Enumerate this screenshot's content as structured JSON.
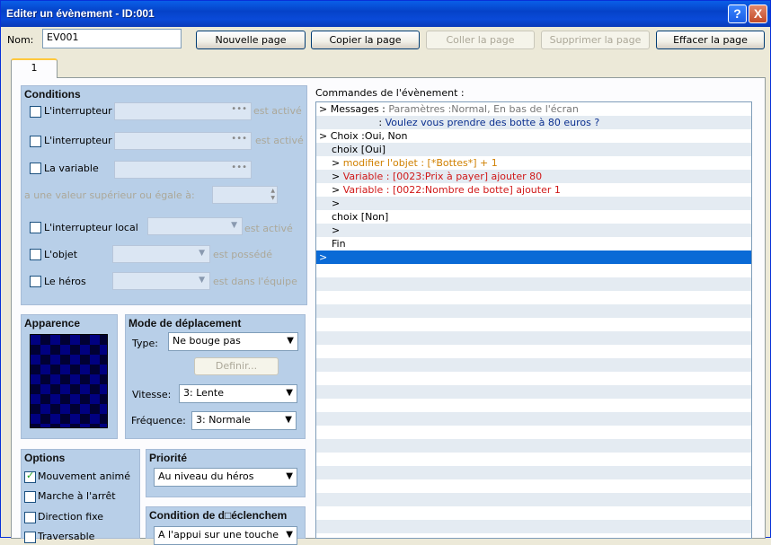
{
  "window": {
    "title": "Editer un évènement - ID:001",
    "help_label": "?",
    "close_label": "X"
  },
  "header": {
    "name_label": "Nom:",
    "name_value": "EV001",
    "buttons": {
      "new_page": "Nouvelle page",
      "copy_page": "Copier la page",
      "paste_page": "Coller la page",
      "delete_page": "Supprimer la page",
      "clear_page": "Effacer la page"
    }
  },
  "tabs": [
    {
      "label": "1"
    }
  ],
  "conditions": {
    "title": "Conditions",
    "switch1_label": "L'interrupteur",
    "switch1_suffix": "est activé",
    "switch2_label": "L'interrupteur",
    "switch2_suffix": "est activé",
    "variable_label": "La variable",
    "variable_value_label": "a une valeur supérieur ou égale à:",
    "local_switch_label": "L'interrupteur local",
    "local_switch_suffix": "est activé",
    "item_label": "L'objet",
    "item_suffix": "est possédé",
    "hero_label": "Le héros",
    "hero_suffix": "est dans l'équipe"
  },
  "appearance": {
    "title": "Apparence"
  },
  "movement": {
    "title": "Mode de déplacement",
    "type_label": "Type:",
    "type_value": "Ne bouge pas",
    "define_button": "Definir...",
    "speed_label": "Vitesse:",
    "speed_value": "3: Lente",
    "frequency_label": "Fréquence:",
    "frequency_value": "3: Normale"
  },
  "options": {
    "title": "Options",
    "items": [
      {
        "label": "Mouvement animé",
        "checked": true
      },
      {
        "label": "Marche à l'arrêt",
        "checked": false
      },
      {
        "label": "Direction fixe",
        "checked": false
      },
      {
        "label": "Traversable",
        "checked": false
      }
    ]
  },
  "priority": {
    "title": "Priorité",
    "value": "Au niveau du héros"
  },
  "trigger": {
    "title": "Condition de d□éclenchem",
    "value": "A l'appui sur une touche"
  },
  "commands": {
    "title": "Commandes de l'évènement :",
    "rows": [
      {
        "parts": [
          [
            "> Messages : ",
            ""
          ],
          [
            "Paramètres :Normal, En bas de l'écran",
            "g"
          ]
        ]
      },
      {
        "parts": [
          [
            "                   : ",
            ""
          ],
          [
            "Voulez vous prendre des botte à 80 euros ?",
            "b"
          ]
        ]
      },
      {
        "parts": [
          [
            "> Choix :Oui, Non",
            ""
          ]
        ]
      },
      {
        "parts": [
          [
            "    choix [Oui]",
            ""
          ]
        ]
      },
      {
        "parts": [
          [
            "    > ",
            ""
          ],
          [
            "modifier l'objet : [*Bottes*] + 1",
            "o"
          ]
        ]
      },
      {
        "parts": [
          [
            "    > ",
            ""
          ],
          [
            "Variable : [0023:Prix à payer] ajouter 80",
            "r"
          ]
        ]
      },
      {
        "parts": [
          [
            "    > ",
            ""
          ],
          [
            "Variable : [0022:Nombre de botte] ajouter 1",
            "r"
          ]
        ]
      },
      {
        "parts": [
          [
            "    >",
            ""
          ]
        ]
      },
      {
        "parts": [
          [
            "    choix [Non]",
            ""
          ]
        ]
      },
      {
        "parts": [
          [
            "    >",
            ""
          ]
        ]
      },
      {
        "parts": [
          [
            "    Fin",
            ""
          ]
        ]
      },
      {
        "parts": [
          [
            ">",
            ""
          ]
        ],
        "selected": true
      }
    ]
  }
}
